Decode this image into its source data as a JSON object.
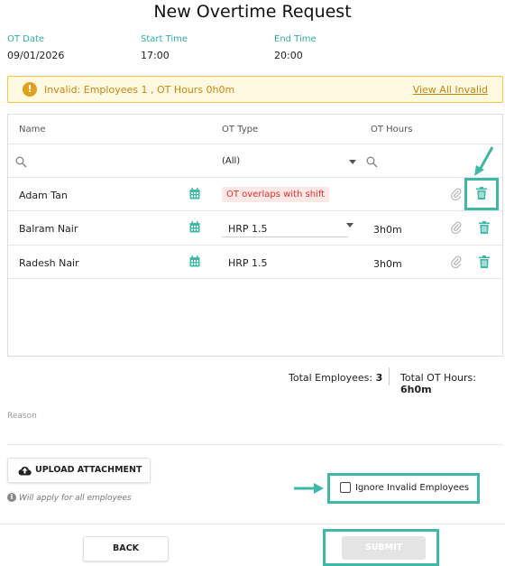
{
  "title": "New Overtime Request",
  "meta": {
    "ot_date_label": "OT Date",
    "ot_date": "09/01/2026",
    "start_label": "Start Time",
    "start": "17:00",
    "end_label": "End Time",
    "end": "20:00"
  },
  "banner": {
    "message": "Invalid: Employees 1 , OT Hours 0h0m",
    "link": "View All Invalid"
  },
  "grid": {
    "headers": [
      "Name",
      "OT Type",
      "OT Hours"
    ],
    "filter_ot_type": "(All)",
    "rows": [
      {
        "name": "Adam Tan",
        "ot_type": "OT overlaps with shift",
        "ot_hours": ""
      },
      {
        "name": "Balram Nair",
        "ot_type": "HRP 1.5",
        "ot_hours": "3h0m"
      },
      {
        "name": "Radesh Nair",
        "ot_type": "HRP 1.5",
        "ot_hours": "3h0m"
      }
    ]
  },
  "summary": {
    "employees_label": "Total Employees:",
    "employees": "3",
    "hours_label": "Total OT Hours:",
    "hours": "6h0m"
  },
  "reason_label": "Reason",
  "upload_label": "UPLOAD ATTACHMENT",
  "upload_note": "Will apply for all employees",
  "ignore_label": "Ignore Invalid Employees",
  "back_label": "BACK",
  "submit_label": "SUBMIT",
  "colors": {
    "accent": "#3fb8a8",
    "warning": "#e0a020",
    "error": "#e03030"
  }
}
